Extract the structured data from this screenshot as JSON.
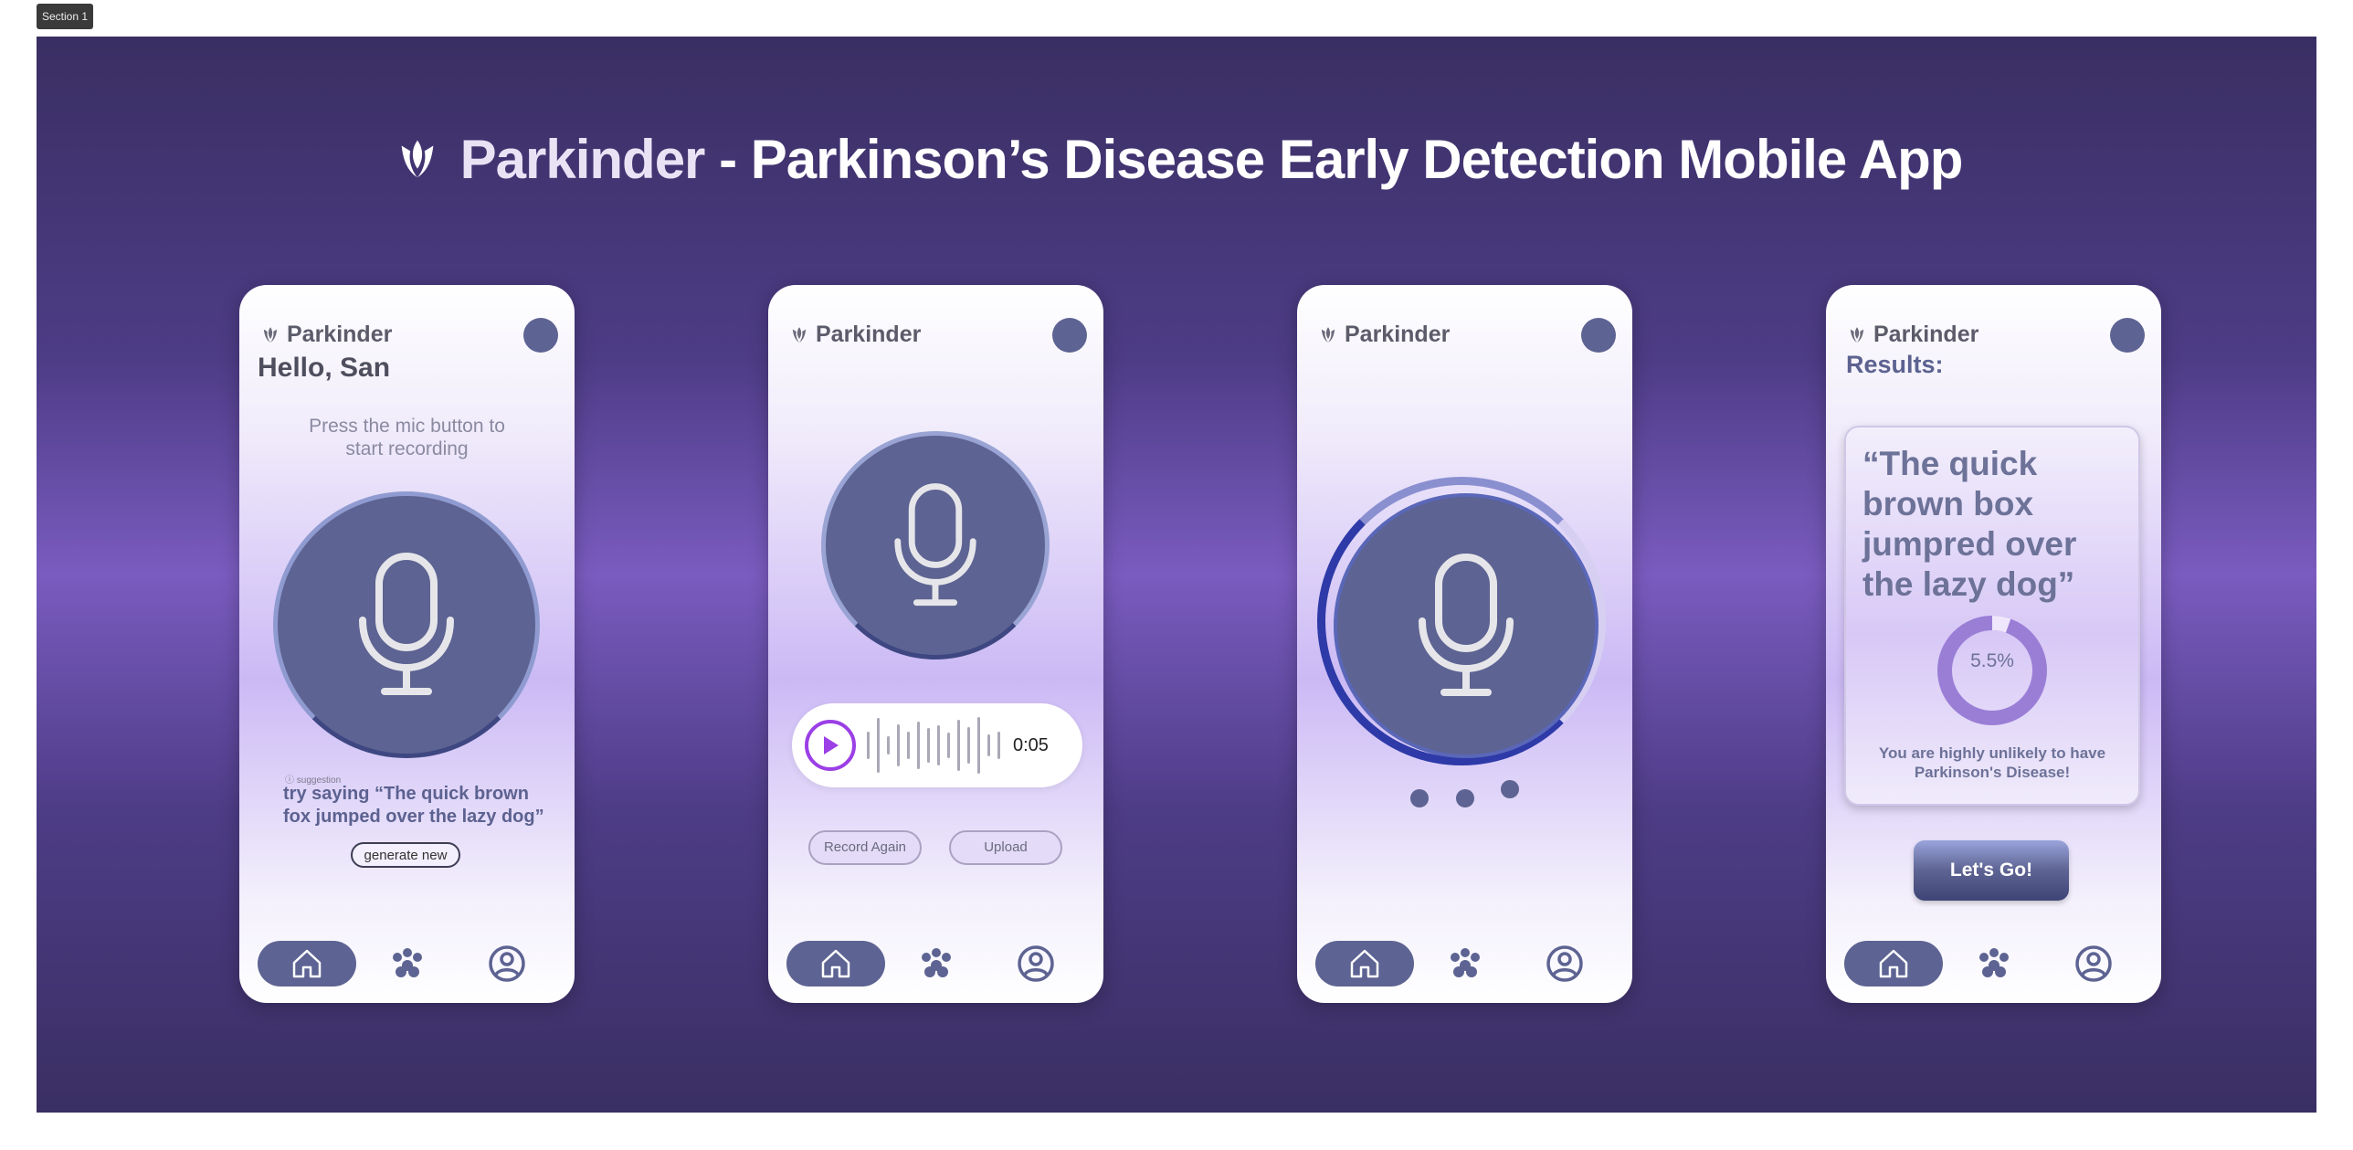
{
  "section_label": "Section 1",
  "headline": {
    "brand": "Parkinder",
    "rest": " - Parkinson’s Disease Early Detection Mobile App"
  },
  "app_name": "Parkinder",
  "screen1": {
    "greeting": "Hello, San",
    "hint_line1": "Press the mic button to",
    "hint_line2": "start recording",
    "suggestion_tag": "ⓘ suggestion",
    "suggestion": "try saying “The quick brown fox jumped over the lazy dog”",
    "generate_button": "generate new"
  },
  "screen2": {
    "time": "0:05",
    "record_again": "Record Again",
    "upload": "Upload"
  },
  "screen4": {
    "title": "Results:",
    "quote": "“The quick brown box jumpred over the lazy dog”",
    "percent": "5.5%",
    "percent_value": 5.5,
    "verdict": "You are highly unlikely to have Parkinson's Disease!",
    "go_button": "Let's Go!"
  },
  "colors": {
    "accent": "#5d6392",
    "play": "#9b3fe6"
  },
  "icons": [
    "tulip-logo-icon",
    "mic-icon",
    "home-icon",
    "paw-icon",
    "profile-icon",
    "play-icon"
  ]
}
